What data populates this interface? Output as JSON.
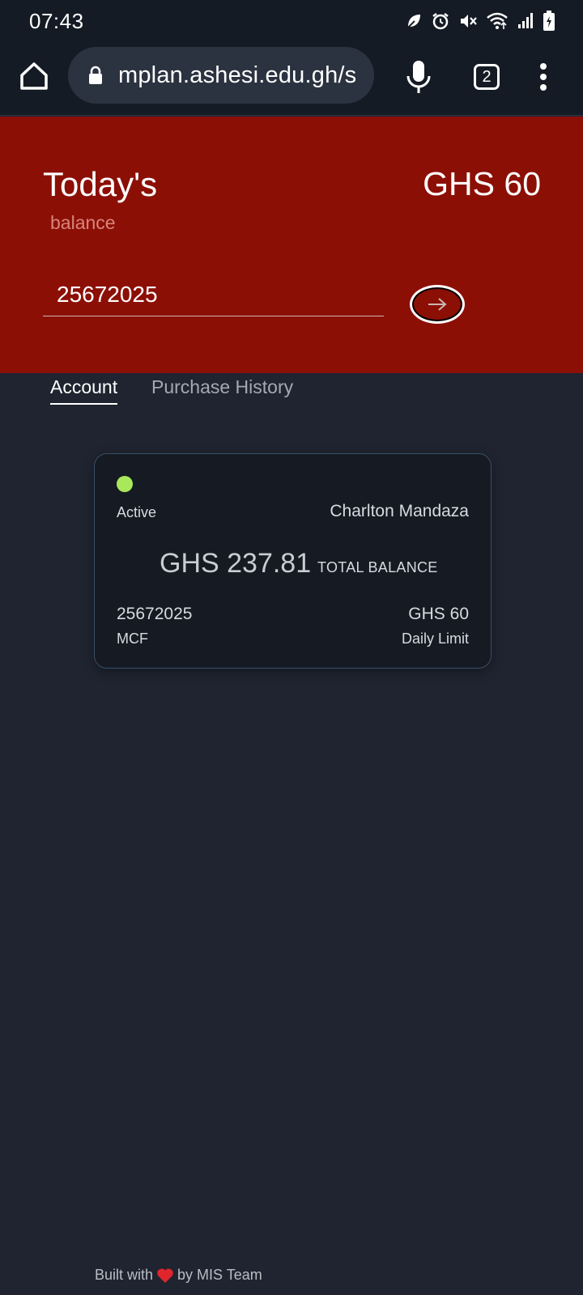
{
  "status_bar": {
    "time": "07:43",
    "icons": [
      "leaf-icon",
      "alarm-icon",
      "mute-icon",
      "wifi-icon",
      "signal-icon",
      "battery-icon"
    ]
  },
  "browser": {
    "url": "mplan.ashesi.edu.gh/s",
    "tab_count": "2",
    "icons": [
      "home-icon",
      "lock-icon",
      "mic-icon",
      "more-vert-icon"
    ]
  },
  "hero": {
    "title": "Today's",
    "subtitle": "balance",
    "amount": "GHS 60",
    "input_value": "25672025",
    "submit_icon": "arrow-right-icon"
  },
  "tabs": [
    {
      "label": "Account",
      "active": true
    },
    {
      "label": "Purchase History",
      "active": false
    }
  ],
  "card": {
    "status": "Active",
    "status_color": "#a8e85a",
    "name": "Charlton Mandaza",
    "balance": "GHS 237.81",
    "balance_label": "TOTAL BALANCE",
    "account_id": "25672025",
    "plan": "MCF",
    "limit": "GHS 60",
    "limit_label": "Daily Limit"
  },
  "footer": {
    "prefix": "Built with",
    "suffix": "by MIS Team",
    "heart_color": "#e0252c"
  },
  "colors": {
    "hero_bg": "#8c0f06",
    "page_bg": "#1f2430",
    "bar_bg": "#151b24"
  }
}
